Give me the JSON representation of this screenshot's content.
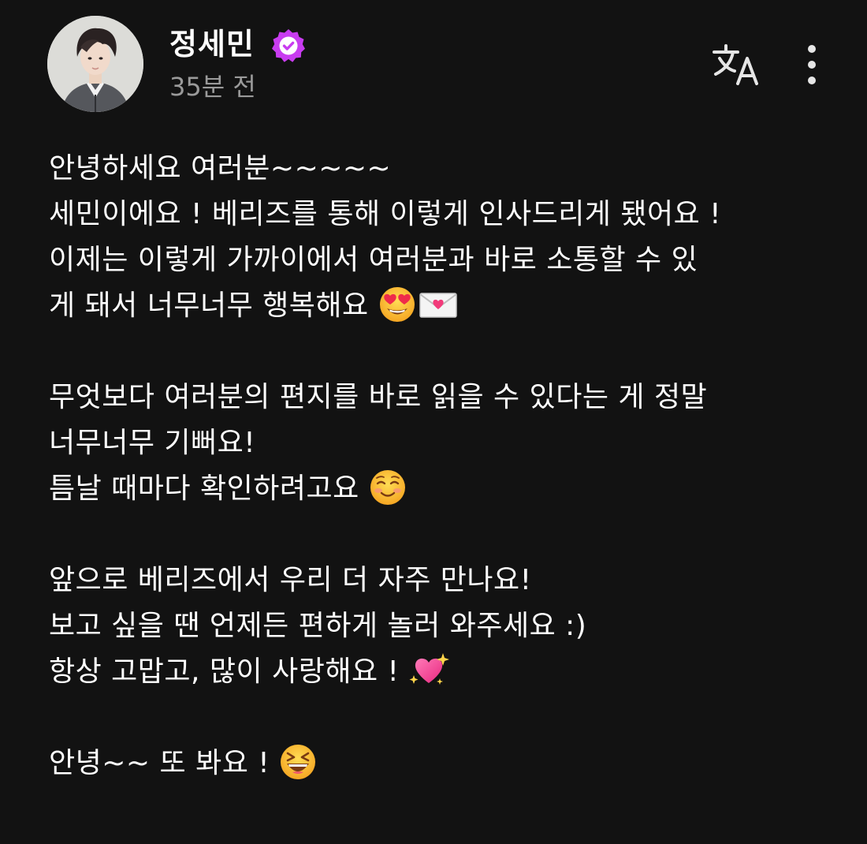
{
  "author": {
    "name": "정세민",
    "verified": true,
    "badge_color": "#c83cf0",
    "avatar": "profile-photo"
  },
  "post": {
    "time": "35분 전",
    "paragraphs": [
      [
        "안녕하세요 여러분~~~~~",
        "세민이에요 ! 베리즈를 통해 이렇게 인사드리게 됐어요 !",
        "이제는 이렇게 가까이에서 여러분과 바로 소통할 수 있",
        "게 돼서 너무너무 행복해요 "
      ],
      [
        "무엇보다 여러분의 편지를 바로 읽을 수 있다는 게 정말",
        "너무너무 기뻐요!",
        "틈날 때마다 확인하려고요 "
      ],
      [
        "앞으로 베리즈에서 우리 더 자주 만나요!",
        "보고 싶을 땐 언제든 편하게 놀러 와주세요 :)",
        "항상 고맙고, 많이 사랑해요 ! "
      ],
      [
        "안녕~~ 또 봐요 ! "
      ]
    ],
    "emojis": {
      "p1": [
        "heart-eyes-emoji",
        "love-letter-emoji"
      ],
      "p2": [
        "smiling-blush-emoji"
      ],
      "p3": [
        "sparkling-heart-emoji"
      ],
      "p4": [
        "grinning-squint-emoji"
      ]
    }
  },
  "actions": {
    "translate_icon": "translate-icon",
    "more_icon": "more-vertical-icon"
  },
  "colors": {
    "background": "#121212",
    "text": "#ffffff",
    "muted": "#9a9a9a"
  }
}
